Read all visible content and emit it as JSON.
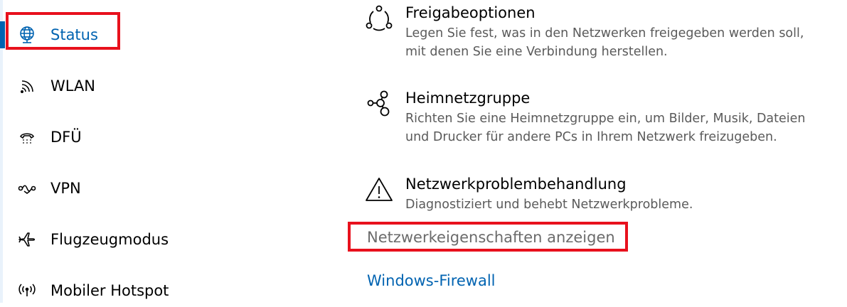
{
  "sidebar": {
    "items": [
      {
        "label": "Status",
        "icon": "globe-icon",
        "selected": true
      },
      {
        "label": "WLAN",
        "icon": "wifi-icon",
        "selected": false
      },
      {
        "label": "DFÜ",
        "icon": "dialup-phone-icon",
        "selected": false
      },
      {
        "label": "VPN",
        "icon": "vpn-icon",
        "selected": false
      },
      {
        "label": "Flugzeugmodus",
        "icon": "airplane-icon",
        "selected": false
      },
      {
        "label": "Mobiler Hotspot",
        "icon": "hotspot-icon",
        "selected": false
      }
    ]
  },
  "main": {
    "sections": [
      {
        "title": "Freigabeoptionen",
        "description_lines": [
          "Legen Sie fest, was in den Netzwerken freigegeben werden soll,",
          "mit denen Sie eine Verbindung herstellen."
        ],
        "icon": "share-icon"
      },
      {
        "title": "Heimnetzgruppe",
        "description_lines": [
          "Richten Sie eine Heimnetzgruppe ein, um Bilder, Musik, Dateien",
          "und Drucker für andere PCs in Ihrem Netzwerk freizugeben."
        ],
        "icon": "homegroup-icon"
      },
      {
        "title": "Netzwerkproblembehandlung",
        "description_lines": [
          "Diagnostiziert und behebt Netzwerkprobleme."
        ],
        "icon": "warning-icon"
      }
    ],
    "links": {
      "network_properties": "Netzwerkeigenschaften anzeigen",
      "firewall": "Windows-Firewall"
    }
  },
  "colors": {
    "accent": "#0063b1",
    "highlight": "#e8111d",
    "description_text": "#5a5a5a",
    "link_grey": "#6b6b6b"
  }
}
